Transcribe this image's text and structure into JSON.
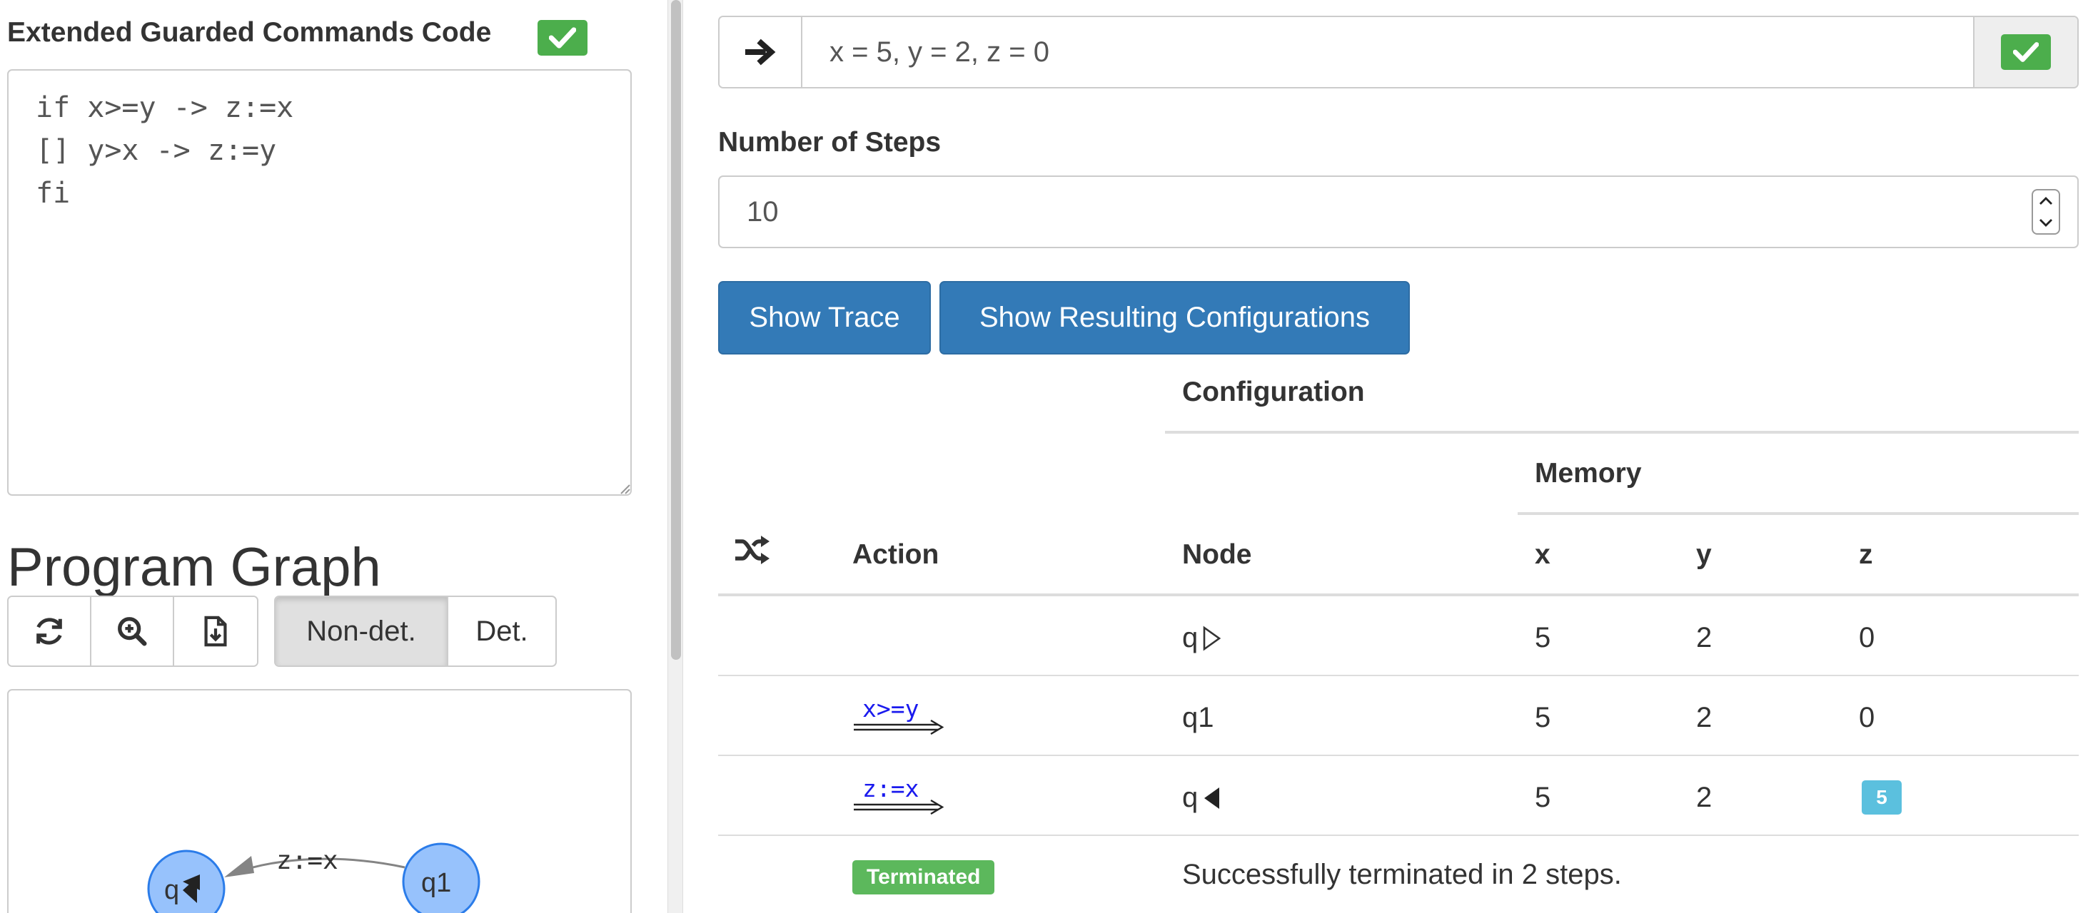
{
  "editor": {
    "title": "Extended Guarded Commands Code",
    "code": "if x>=y -> z:=x\n[] y>x -> z:=y\nfi"
  },
  "program_graph": {
    "title": "Program Graph",
    "toolbar": {
      "mode_nondet_label": "Non-det.",
      "mode_det_label": "Det."
    },
    "nodes": [
      "q◀",
      "q1"
    ],
    "edge_label": "z:=x"
  },
  "config": {
    "input_value": "x = 5, y = 2, z = 0",
    "steps_label": "Number of Steps",
    "steps_value": "10",
    "show_trace_label": "Show Trace",
    "show_configs_label": "Show Resulting Configurations"
  },
  "trace_table": {
    "header_configuration": "Configuration",
    "header_memory": "Memory",
    "header_action": "Action",
    "header_node": "Node",
    "header_x": "x",
    "header_y": "y",
    "header_z": "z",
    "rows": [
      {
        "action": "",
        "node": "q",
        "x": "5",
        "y": "2",
        "z": "0"
      },
      {
        "action": "x>=y",
        "node": "q1",
        "x": "5",
        "y": "2",
        "z": "0"
      },
      {
        "action": "z:=x",
        "node": "q",
        "x": "5",
        "y": "2",
        "z": "5"
      }
    ],
    "terminated_label": "Terminated",
    "termination_message": "Successfully terminated in 2 steps."
  },
  "colors": {
    "primary": "#337ab7",
    "success": "#5cb85c",
    "info": "#5bc0de",
    "node_fill": "#97c2fc",
    "node_stroke": "#2b7ce9",
    "action_text": "#1a1aee"
  },
  "icons": [
    "check-icon",
    "refresh-icon",
    "zoom-icon",
    "export-icon",
    "arrow-right-icon",
    "shuffle-icon",
    "spinner-up-icon",
    "spinner-down-icon",
    "start-triangle-icon",
    "end-triangle-icon"
  ]
}
